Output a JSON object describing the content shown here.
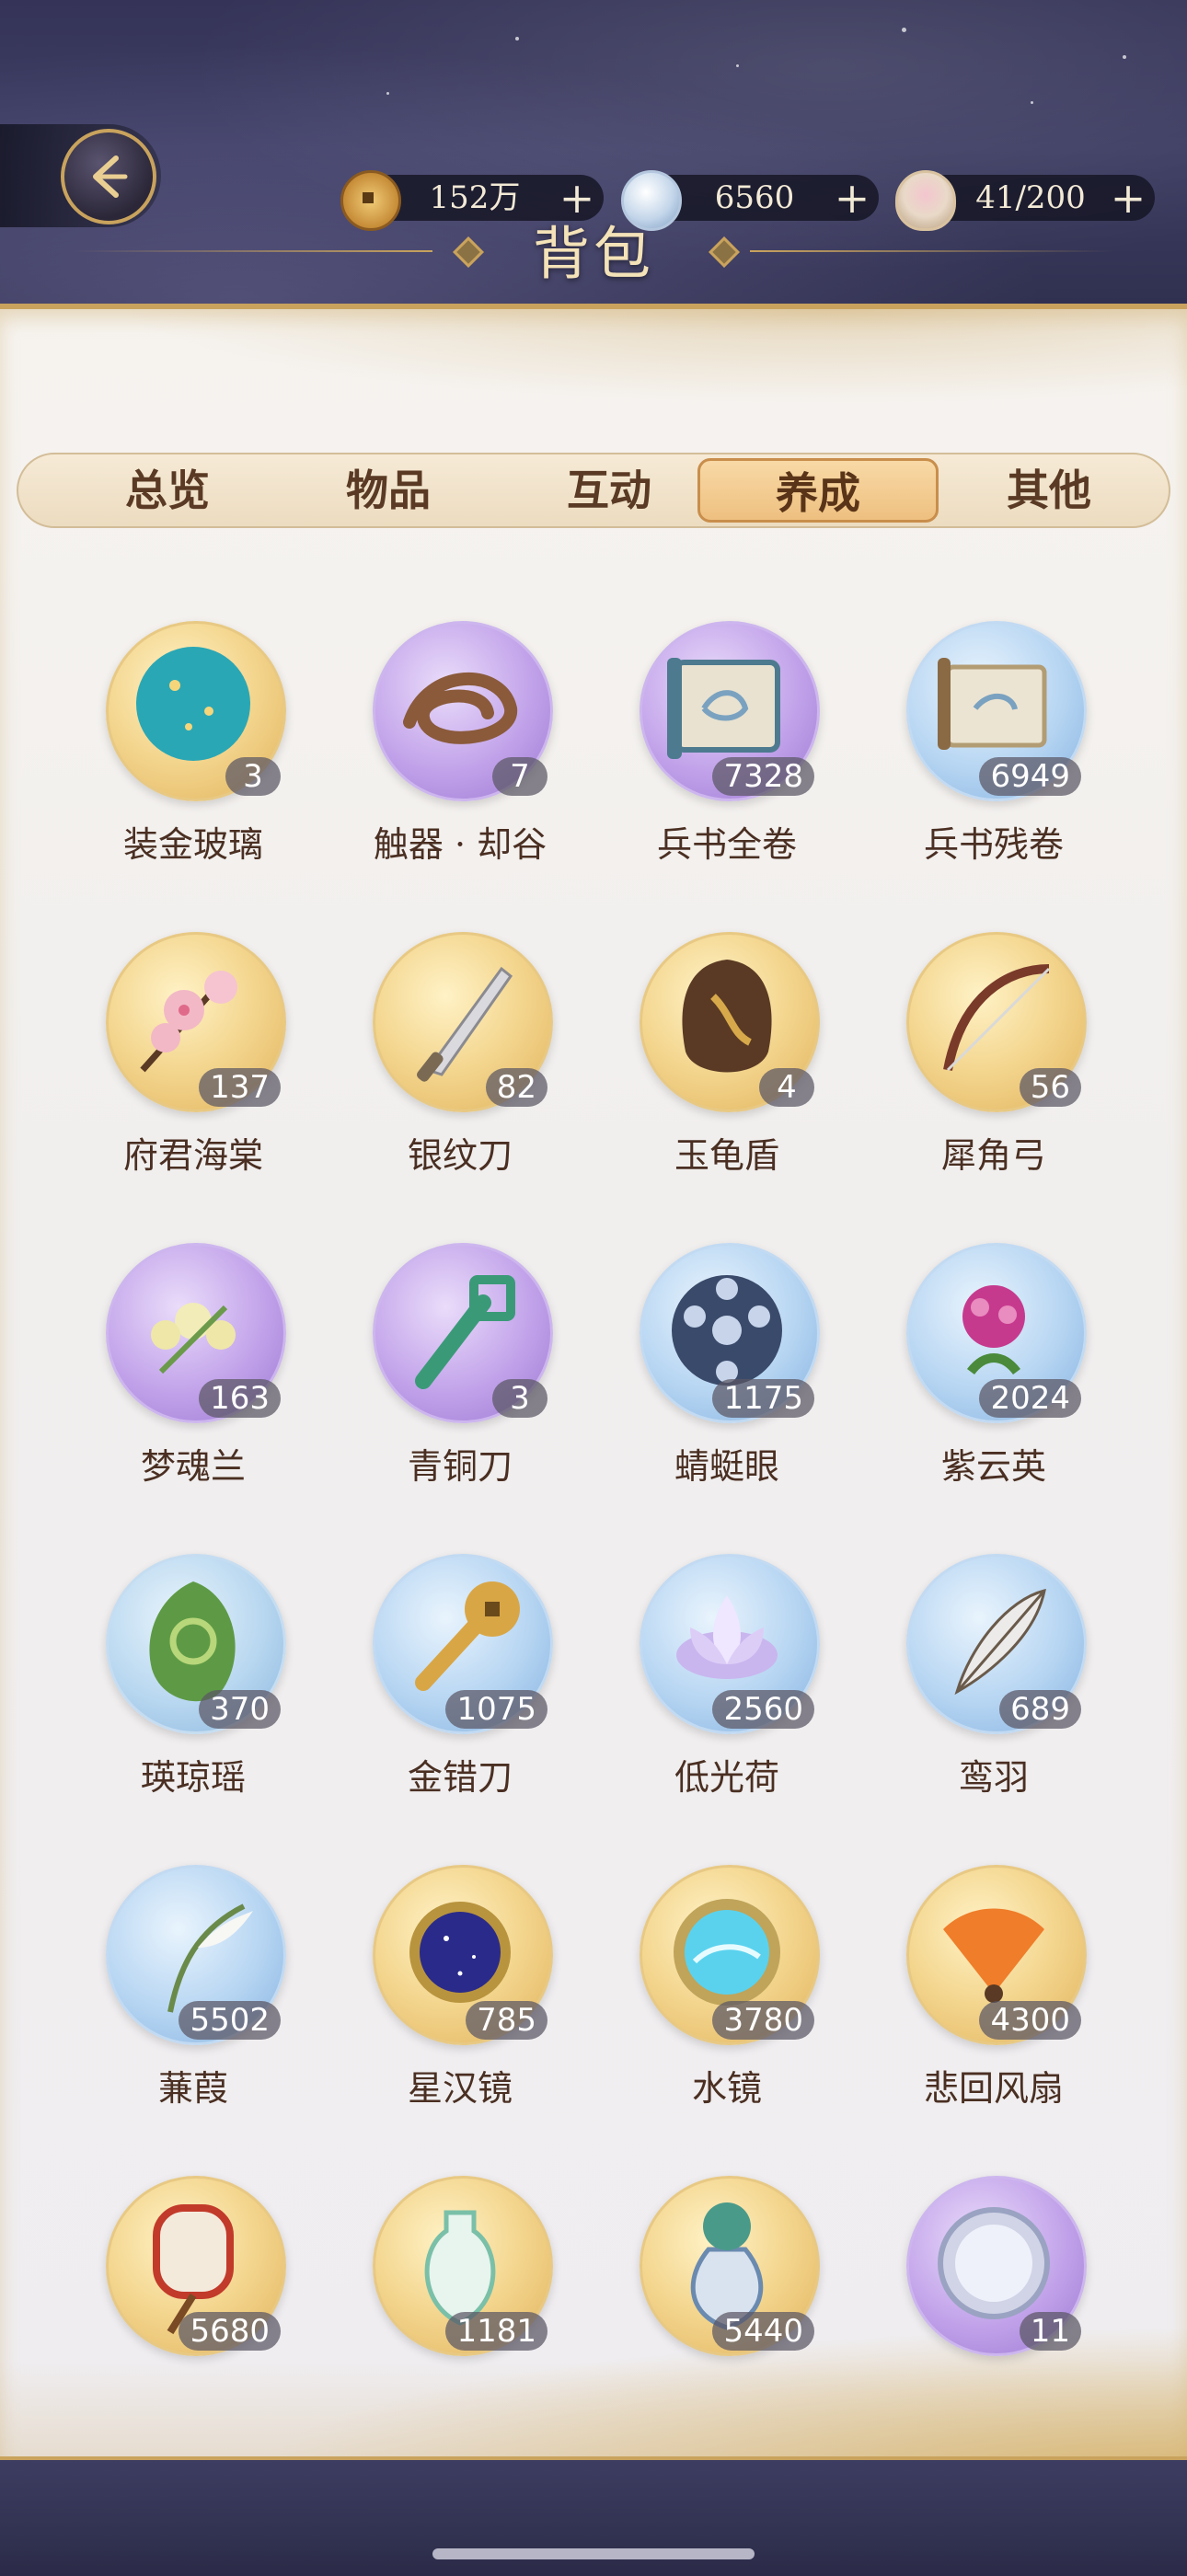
{
  "header": {
    "title": "背包",
    "currencies": [
      {
        "icon": "copper-coin-icon",
        "value": "152万"
      },
      {
        "icon": "jade-orb-icon",
        "value": "6560"
      },
      {
        "icon": "tea-bowl-icon",
        "value": "41/200"
      }
    ]
  },
  "tabs": [
    {
      "label": "总览",
      "active": false
    },
    {
      "label": "物品",
      "active": false
    },
    {
      "label": "互动",
      "active": false
    },
    {
      "label": "养成",
      "active": true
    },
    {
      "label": "其他",
      "active": false
    }
  ],
  "items": [
    {
      "name": "装金玻璃",
      "count": "3",
      "bg": "gold",
      "icon": "gold-glass-orb-icon"
    },
    {
      "name": "触器 · 却谷",
      "count": "7",
      "bg": "purple",
      "icon": "coiled-rope-icon"
    },
    {
      "name": "兵书全卷",
      "count": "7328",
      "bg": "purple",
      "icon": "full-scroll-icon"
    },
    {
      "name": "兵书残卷",
      "count": "6949",
      "bg": "blue",
      "icon": "scroll-fragment-icon"
    },
    {
      "name": "府君海棠",
      "count": "137",
      "bg": "gold",
      "icon": "pink-blossom-icon"
    },
    {
      "name": "银纹刀",
      "count": "82",
      "bg": "gold",
      "icon": "silver-knife-icon"
    },
    {
      "name": "玉龟盾",
      "count": "4",
      "bg": "gold",
      "icon": "tortoise-shield-icon"
    },
    {
      "name": "犀角弓",
      "count": "56",
      "bg": "gold",
      "icon": "bow-icon"
    },
    {
      "name": "梦魂兰",
      "count": "163",
      "bg": "purple",
      "icon": "orchid-icon"
    },
    {
      "name": "青铜刀",
      "count": "3",
      "bg": "purple",
      "icon": "bronze-blade-icon"
    },
    {
      "name": "蜻蜓眼",
      "count": "1175",
      "bg": "blue",
      "icon": "dragonfly-eye-bead-icon"
    },
    {
      "name": "紫云英",
      "count": "2024",
      "bg": "blue",
      "icon": "purple-clover-flower-icon"
    },
    {
      "name": "瑛琼瑶",
      "count": "370",
      "bg": "green",
      "icon": "jade-pendant-icon"
    },
    {
      "name": "金错刀",
      "count": "1075",
      "bg": "blue",
      "icon": "coin-knife-icon"
    },
    {
      "name": "低光荷",
      "count": "2560",
      "bg": "blue",
      "icon": "lotus-icon"
    },
    {
      "name": "鸾羽",
      "count": "689",
      "bg": "blue",
      "icon": "feather-icon"
    },
    {
      "name": "蒹葭",
      "count": "5502",
      "bg": "blue",
      "icon": "reed-icon"
    },
    {
      "name": "星汉镜",
      "count": "785",
      "bg": "gold",
      "icon": "starry-mirror-icon"
    },
    {
      "name": "水镜",
      "count": "3780",
      "bg": "gold",
      "icon": "water-mirror-icon"
    },
    {
      "name": "悲回风扇",
      "count": "4300",
      "bg": "gold",
      "icon": "fan-icon"
    },
    {
      "name": "",
      "count": "5680",
      "bg": "gold",
      "icon": "embroidered-fan-icon"
    },
    {
      "name": "",
      "count": "1181",
      "bg": "gold",
      "icon": "jade-vase-icon"
    },
    {
      "name": "",
      "count": "5440",
      "bg": "gold",
      "icon": "bonsai-vase-icon"
    },
    {
      "name": "",
      "count": "11",
      "bg": "purple",
      "icon": "silver-mirror-icon"
    }
  ],
  "colors": {
    "accent_gold": "#c9a35d",
    "text_brown": "#4a2f22",
    "tab_active": "#eec080"
  }
}
